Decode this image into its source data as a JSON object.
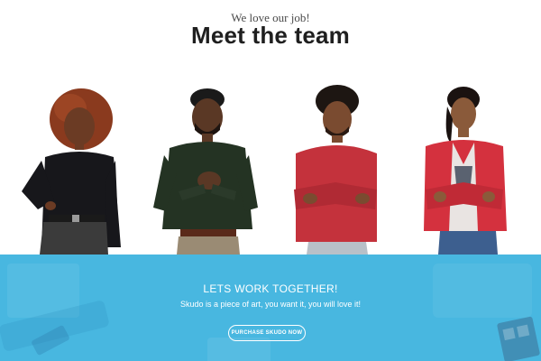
{
  "team": {
    "eyebrow": "We love our job!",
    "title": "Meet the team",
    "members": [
      {
        "name_key": "member-1",
        "photo": "woman-black-sweater-photo"
      },
      {
        "name_key": "member-2",
        "photo": "man-green-shirt-photo"
      },
      {
        "name_key": "member-3",
        "photo": "man-red-sweater-photo"
      },
      {
        "name_key": "member-4",
        "photo": "woman-red-blazer-photo"
      }
    ]
  },
  "cta": {
    "heading": "LETS WORK TOGETHER!",
    "text": "Skudo is a piece of art, you want it, you will love it!",
    "button_label": "PURCHASE SKUDO NOW"
  },
  "colors": {
    "cta_background": "#48b7e0",
    "heading_text": "#1f1f1f",
    "button_border": "#ffffff"
  }
}
